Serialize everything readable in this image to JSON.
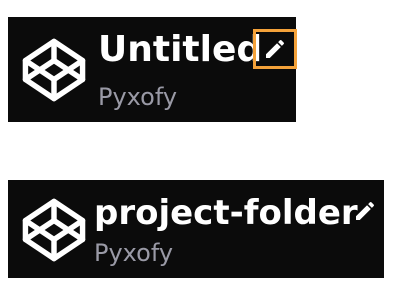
{
  "headers": [
    {
      "title": "Untitled",
      "owner": "Pyxofy",
      "logo_icon": "codepen-cube-icon",
      "edit_icon": "pencil-icon",
      "edit_focused": true,
      "focus_color": "#f4a23a"
    },
    {
      "title": "project-folder",
      "owner": "Pyxofy",
      "logo_icon": "codepen-cube-icon",
      "edit_icon": "pencil-icon",
      "edit_focused": false
    }
  ],
  "colors": {
    "header_background": "#0b0b0b",
    "title_text": "#ffffff",
    "owner_text": "#9a9aa6",
    "page_background": "#ffffff"
  }
}
